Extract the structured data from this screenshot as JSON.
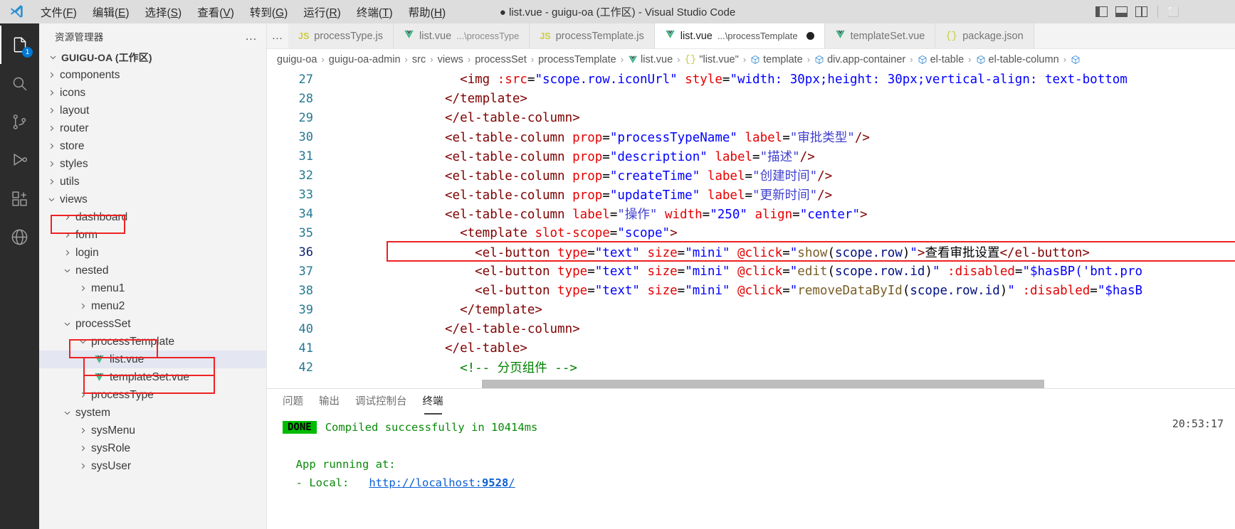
{
  "titlebar": {
    "menus": [
      {
        "label": "文件(F)",
        "mnemonic": "F"
      },
      {
        "label": "编辑(E)",
        "mnemonic": "E"
      },
      {
        "label": "选择(S)",
        "mnemonic": "S"
      },
      {
        "label": "查看(V)",
        "mnemonic": "V"
      },
      {
        "label": "转到(G)",
        "mnemonic": "G"
      },
      {
        "label": "运行(R)",
        "mnemonic": "R"
      },
      {
        "label": "终端(T)",
        "mnemonic": "T"
      },
      {
        "label": "帮助(H)",
        "mnemonic": "H"
      }
    ],
    "window_title": "● list.vue - guigu-oa (工作区) - Visual Studio Code",
    "window_controls": "⬜"
  },
  "activitybar": {
    "items": [
      {
        "name": "explorer",
        "badge": "1"
      },
      {
        "name": "search",
        "badge": ""
      },
      {
        "name": "source-control",
        "badge": ""
      },
      {
        "name": "run-debug",
        "badge": ""
      },
      {
        "name": "extensions",
        "badge": ""
      },
      {
        "name": "remote-explorer",
        "badge": ""
      }
    ]
  },
  "sidebar": {
    "title": "资源管理器",
    "more_label": "…",
    "root": "GUIGU-OA (工作区)",
    "tree": [
      {
        "label": "components",
        "indent": 2,
        "type": "folder",
        "state": "collapsed"
      },
      {
        "label": "icons",
        "indent": 2,
        "type": "folder",
        "state": "collapsed"
      },
      {
        "label": "layout",
        "indent": 2,
        "type": "folder",
        "state": "collapsed"
      },
      {
        "label": "router",
        "indent": 2,
        "type": "folder",
        "state": "collapsed"
      },
      {
        "label": "store",
        "indent": 2,
        "type": "folder",
        "state": "collapsed"
      },
      {
        "label": "styles",
        "indent": 2,
        "type": "folder",
        "state": "collapsed"
      },
      {
        "label": "utils",
        "indent": 2,
        "type": "folder",
        "state": "collapsed"
      },
      {
        "label": "views",
        "indent": 2,
        "type": "folder",
        "state": "expanded",
        "highlight": true
      },
      {
        "label": "dashboard",
        "indent": 3,
        "type": "folder",
        "state": "collapsed"
      },
      {
        "label": "form",
        "indent": 3,
        "type": "folder",
        "state": "collapsed"
      },
      {
        "label": "login",
        "indent": 3,
        "type": "folder",
        "state": "collapsed"
      },
      {
        "label": "nested",
        "indent": 3,
        "type": "folder",
        "state": "expanded"
      },
      {
        "label": "menu1",
        "indent": 4,
        "type": "folder",
        "state": "collapsed"
      },
      {
        "label": "menu2",
        "indent": 4,
        "type": "folder",
        "state": "collapsed"
      },
      {
        "label": "processSet",
        "indent": 3,
        "type": "folder",
        "state": "expanded",
        "highlight": true
      },
      {
        "label": "processTemplate",
        "indent": 4,
        "type": "folder",
        "state": "expanded",
        "highlight": true
      },
      {
        "label": "list.vue",
        "indent": 5,
        "type": "vue",
        "state": "file",
        "selected": true,
        "highlight": true
      },
      {
        "label": "templateSet.vue",
        "indent": 5,
        "type": "vue",
        "state": "file"
      },
      {
        "label": "processType",
        "indent": 4,
        "type": "folder",
        "state": "collapsed"
      },
      {
        "label": "system",
        "indent": 3,
        "type": "folder",
        "state": "expanded"
      },
      {
        "label": "sysMenu",
        "indent": 4,
        "type": "folder",
        "state": "collapsed"
      },
      {
        "label": "sysRole",
        "indent": 4,
        "type": "folder",
        "state": "collapsed"
      },
      {
        "label": "sysUser",
        "indent": 4,
        "type": "folder",
        "state": "collapsed"
      }
    ]
  },
  "tabs": {
    "overflow_label": "…",
    "items": [
      {
        "icon": "js",
        "name": "processType.js",
        "sub": "",
        "active": false,
        "dirty": false
      },
      {
        "icon": "vue",
        "name": "list.vue",
        "sub": "...\\processType",
        "active": false,
        "dirty": false
      },
      {
        "icon": "js",
        "name": "processTemplate.js",
        "sub": "",
        "active": false,
        "dirty": false
      },
      {
        "icon": "vue",
        "name": "list.vue",
        "sub": "...\\processTemplate",
        "active": true,
        "dirty": true
      },
      {
        "icon": "vue",
        "name": "templateSet.vue",
        "sub": "",
        "active": false,
        "dirty": false
      },
      {
        "icon": "json",
        "name": "package.json",
        "sub": "",
        "active": false,
        "dirty": false
      }
    ]
  },
  "breadcrumb": {
    "separator": "›",
    "items": [
      {
        "label": "guigu-oa",
        "icon": "none"
      },
      {
        "label": "guigu-oa-admin",
        "icon": "none"
      },
      {
        "label": "src",
        "icon": "none"
      },
      {
        "label": "views",
        "icon": "none"
      },
      {
        "label": "processSet",
        "icon": "none"
      },
      {
        "label": "processTemplate",
        "icon": "none"
      },
      {
        "label": "list.vue",
        "icon": "vue"
      },
      {
        "label": "\"list.vue\"",
        "icon": "json-braces"
      },
      {
        "label": "template",
        "icon": "symbol-field"
      },
      {
        "label": "div.app-container",
        "icon": "symbol-field"
      },
      {
        "label": "el-table",
        "icon": "symbol-field"
      },
      {
        "label": "el-table-column",
        "icon": "symbol-field"
      },
      {
        "label": "",
        "icon": "symbol-field"
      }
    ]
  },
  "code": {
    "language": "vue-html",
    "first_line": 27,
    "current_line": 36,
    "lines": [
      {
        "n": 27,
        "tokens": [
          {
            "t": "  ",
            "c": "plain"
          },
          {
            "t": "<img ",
            "c": "tag"
          },
          {
            "t": ":src",
            "c": "attr"
          },
          {
            "t": "=",
            "c": "punct"
          },
          {
            "t": "\"scope.row.iconUrl\"",
            "c": "str"
          },
          {
            "t": " ",
            "c": "plain"
          },
          {
            "t": "style",
            "c": "attr"
          },
          {
            "t": "=",
            "c": "punct"
          },
          {
            "t": "\"width: 30px;height: 30px;vertical-align: text-bottom",
            "c": "str"
          }
        ]
      },
      {
        "n": 28,
        "tokens": [
          {
            "t": "</template>",
            "c": "tag"
          }
        ]
      },
      {
        "n": 29,
        "tokens": [
          {
            "t": "</el-table-column>",
            "c": "tag"
          }
        ]
      },
      {
        "n": 30,
        "tokens": [
          {
            "t": "<el-table-column ",
            "c": "tag"
          },
          {
            "t": "prop",
            "c": "attr"
          },
          {
            "t": "=",
            "c": "punct"
          },
          {
            "t": "\"processTypeName\"",
            "c": "str"
          },
          {
            "t": " ",
            "c": "plain"
          },
          {
            "t": "label",
            "c": "attr"
          },
          {
            "t": "=",
            "c": "punct"
          },
          {
            "t": "\"审批类型\"",
            "c": "strcn"
          },
          {
            "t": "/>",
            "c": "tag"
          }
        ]
      },
      {
        "n": 31,
        "tokens": [
          {
            "t": "<el-table-column ",
            "c": "tag"
          },
          {
            "t": "prop",
            "c": "attr"
          },
          {
            "t": "=",
            "c": "punct"
          },
          {
            "t": "\"description\"",
            "c": "str"
          },
          {
            "t": " ",
            "c": "plain"
          },
          {
            "t": "label",
            "c": "attr"
          },
          {
            "t": "=",
            "c": "punct"
          },
          {
            "t": "\"描述\"",
            "c": "strcn"
          },
          {
            "t": "/>",
            "c": "tag"
          }
        ]
      },
      {
        "n": 32,
        "tokens": [
          {
            "t": "<el-table-column ",
            "c": "tag"
          },
          {
            "t": "prop",
            "c": "attr"
          },
          {
            "t": "=",
            "c": "punct"
          },
          {
            "t": "\"createTime\"",
            "c": "str"
          },
          {
            "t": " ",
            "c": "plain"
          },
          {
            "t": "label",
            "c": "attr"
          },
          {
            "t": "=",
            "c": "punct"
          },
          {
            "t": "\"创建时间\"",
            "c": "strcn"
          },
          {
            "t": "/>",
            "c": "tag"
          }
        ]
      },
      {
        "n": 33,
        "tokens": [
          {
            "t": "<el-table-column ",
            "c": "tag"
          },
          {
            "t": "prop",
            "c": "attr"
          },
          {
            "t": "=",
            "c": "punct"
          },
          {
            "t": "\"updateTime\"",
            "c": "str"
          },
          {
            "t": " ",
            "c": "plain"
          },
          {
            "t": "label",
            "c": "attr"
          },
          {
            "t": "=",
            "c": "punct"
          },
          {
            "t": "\"更新时间\"",
            "c": "strcn"
          },
          {
            "t": "/>",
            "c": "tag"
          }
        ]
      },
      {
        "n": 34,
        "tokens": [
          {
            "t": "<el-table-column ",
            "c": "tag"
          },
          {
            "t": "label",
            "c": "attr"
          },
          {
            "t": "=",
            "c": "punct"
          },
          {
            "t": "\"操作\"",
            "c": "strcn"
          },
          {
            "t": " ",
            "c": "plain"
          },
          {
            "t": "width",
            "c": "attr"
          },
          {
            "t": "=",
            "c": "punct"
          },
          {
            "t": "\"250\"",
            "c": "str"
          },
          {
            "t": " ",
            "c": "plain"
          },
          {
            "t": "align",
            "c": "attr"
          },
          {
            "t": "=",
            "c": "punct"
          },
          {
            "t": "\"center\"",
            "c": "str"
          },
          {
            "t": ">",
            "c": "tag"
          }
        ]
      },
      {
        "n": 35,
        "tokens": [
          {
            "t": "  <template ",
            "c": "tag"
          },
          {
            "t": "slot-scope",
            "c": "attr"
          },
          {
            "t": "=",
            "c": "punct"
          },
          {
            "t": "\"scope\"",
            "c": "str"
          },
          {
            "t": ">",
            "c": "tag"
          }
        ]
      },
      {
        "n": 36,
        "tokens": [
          {
            "t": "    <el-button ",
            "c": "tag"
          },
          {
            "t": "type",
            "c": "attr"
          },
          {
            "t": "=",
            "c": "punct"
          },
          {
            "t": "\"text\"",
            "c": "str"
          },
          {
            "t": " ",
            "c": "plain"
          },
          {
            "t": "size",
            "c": "attr"
          },
          {
            "t": "=",
            "c": "punct"
          },
          {
            "t": "\"mini\"",
            "c": "str"
          },
          {
            "t": " ",
            "c": "plain"
          },
          {
            "t": "@click",
            "c": "attr"
          },
          {
            "t": "=",
            "c": "punct"
          },
          {
            "t": "\"",
            "c": "str"
          },
          {
            "t": "show",
            "c": "fn"
          },
          {
            "t": "(",
            "c": "punct"
          },
          {
            "t": "scope.row",
            "c": "var"
          },
          {
            "t": ")",
            "c": "punct"
          },
          {
            "t": "\"",
            "c": "str"
          },
          {
            "t": ">",
            "c": "tag"
          },
          {
            "t": "查看审批设置",
            "c": "plain"
          },
          {
            "t": "</el-button>",
            "c": "tag"
          }
        ]
      },
      {
        "n": 37,
        "tokens": [
          {
            "t": "    <el-button ",
            "c": "tag"
          },
          {
            "t": "type",
            "c": "attr"
          },
          {
            "t": "=",
            "c": "punct"
          },
          {
            "t": "\"text\"",
            "c": "str"
          },
          {
            "t": " ",
            "c": "plain"
          },
          {
            "t": "size",
            "c": "attr"
          },
          {
            "t": "=",
            "c": "punct"
          },
          {
            "t": "\"mini\"",
            "c": "str"
          },
          {
            "t": " ",
            "c": "plain"
          },
          {
            "t": "@click",
            "c": "attr"
          },
          {
            "t": "=",
            "c": "punct"
          },
          {
            "t": "\"",
            "c": "str"
          },
          {
            "t": "edit",
            "c": "fn"
          },
          {
            "t": "(",
            "c": "punct"
          },
          {
            "t": "scope.row.id",
            "c": "var"
          },
          {
            "t": ")",
            "c": "punct"
          },
          {
            "t": "\"",
            "c": "str"
          },
          {
            "t": " ",
            "c": "plain"
          },
          {
            "t": ":disabled",
            "c": "attr"
          },
          {
            "t": "=",
            "c": "punct"
          },
          {
            "t": "\"$hasBP('bnt.pro",
            "c": "str"
          }
        ]
      },
      {
        "n": 38,
        "tokens": [
          {
            "t": "    <el-button ",
            "c": "tag"
          },
          {
            "t": "type",
            "c": "attr"
          },
          {
            "t": "=",
            "c": "punct"
          },
          {
            "t": "\"text\"",
            "c": "str"
          },
          {
            "t": " ",
            "c": "plain"
          },
          {
            "t": "size",
            "c": "attr"
          },
          {
            "t": "=",
            "c": "punct"
          },
          {
            "t": "\"mini\"",
            "c": "str"
          },
          {
            "t": " ",
            "c": "plain"
          },
          {
            "t": "@click",
            "c": "attr"
          },
          {
            "t": "=",
            "c": "punct"
          },
          {
            "t": "\"",
            "c": "str"
          },
          {
            "t": "removeDataById",
            "c": "fn"
          },
          {
            "t": "(",
            "c": "punct"
          },
          {
            "t": "scope.row.id",
            "c": "var"
          },
          {
            "t": ")",
            "c": "punct"
          },
          {
            "t": "\"",
            "c": "str"
          },
          {
            "t": " ",
            "c": "plain"
          },
          {
            "t": ":disabled",
            "c": "attr"
          },
          {
            "t": "=",
            "c": "punct"
          },
          {
            "t": "\"$hasB",
            "c": "str"
          }
        ]
      },
      {
        "n": 39,
        "tokens": [
          {
            "t": "  </template>",
            "c": "tag"
          }
        ]
      },
      {
        "n": 40,
        "tokens": [
          {
            "t": "</el-table-column>",
            "c": "tag"
          }
        ]
      },
      {
        "n": 41,
        "tokens": [
          {
            "t": "</el-table>",
            "c": "tag"
          }
        ]
      },
      {
        "n": 42,
        "tokens": [
          {
            "t": "  <!-- 分页组件 -->",
            "c": "cmt"
          }
        ]
      }
    ]
  },
  "panel": {
    "tabs": [
      {
        "label": "问题",
        "active": false
      },
      {
        "label": "输出",
        "active": false
      },
      {
        "label": "调试控制台",
        "active": false
      },
      {
        "label": "终端",
        "active": true
      }
    ],
    "timestamp": "20:53:17",
    "terminal": [
      {
        "badge": "DONE",
        "text": "Compiled successfully in 10414ms",
        "color": "green"
      },
      {
        "badge": "",
        "text": "",
        "color": "green"
      },
      {
        "badge": "",
        "text": "  App running at:",
        "color": "green"
      },
      {
        "badge": "",
        "text": "  - Local:   http://localhost:9528/",
        "color": "green",
        "link": "http://localhost:9528/",
        "link_bold": "9528"
      }
    ]
  },
  "colors": {
    "accent": "#0078d4",
    "highlight_box": "#ee2222",
    "done_badge": "#00bb00",
    "terminal_green": "#0a8a0a",
    "selected_row": "#e4e6f1"
  }
}
